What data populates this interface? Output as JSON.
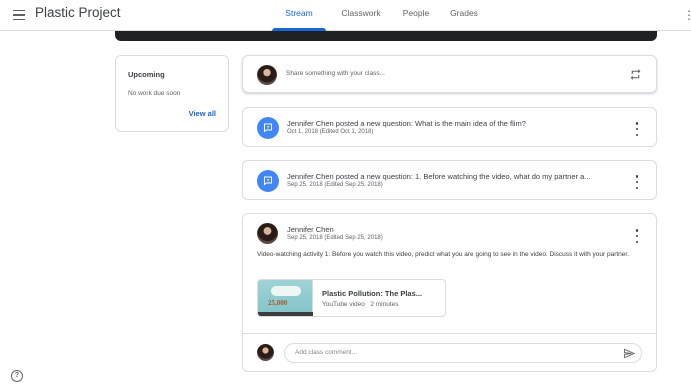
{
  "header": {
    "app_title": "Plastic Project",
    "tabs": [
      {
        "label": "Stream",
        "active": true
      },
      {
        "label": "Classwork",
        "active": false
      },
      {
        "label": "People",
        "active": false
      },
      {
        "label": "Grades",
        "active": false
      }
    ]
  },
  "upcoming": {
    "title": "Upcoming",
    "empty_text": "No work due soon",
    "view_all": "View all"
  },
  "share": {
    "placeholder": "Share something with your class..."
  },
  "stream": {
    "questions": [
      {
        "title": "Jennifer Chen posted a new question: What is the main idea of the flim?",
        "date": "Oct 1, 2018 (Edited Oct 1, 2018)"
      },
      {
        "title": "Jennifer Chen posted a new question: 1. Before watching the video, what do my partner a...",
        "date": "Sep 25, 2018 (Edited Sep 25, 2018)"
      }
    ],
    "post": {
      "author": "Jennifer Chen",
      "date": "Sep 25, 2018 (Edited Sep 25, 2018)",
      "body": "Video-watching activity 1: Before you watch this video, predict what you are going to see in the video.  Discuss it with your partner.",
      "attachment": {
        "title": "Plastic Pollution: The Plas...",
        "type": "YouTube video",
        "duration": "2 minutes",
        "thumbnail_text": "25,000"
      },
      "comment_placeholder": "Add class comment..."
    }
  },
  "colors": {
    "accent": "#1967d2",
    "question_icon_bg": "#4285f4",
    "border": "#dadce0"
  },
  "icons": [
    "menu-icon",
    "more-vert-icon",
    "repost-icon",
    "question-icon",
    "send-icon",
    "help-icon"
  ]
}
